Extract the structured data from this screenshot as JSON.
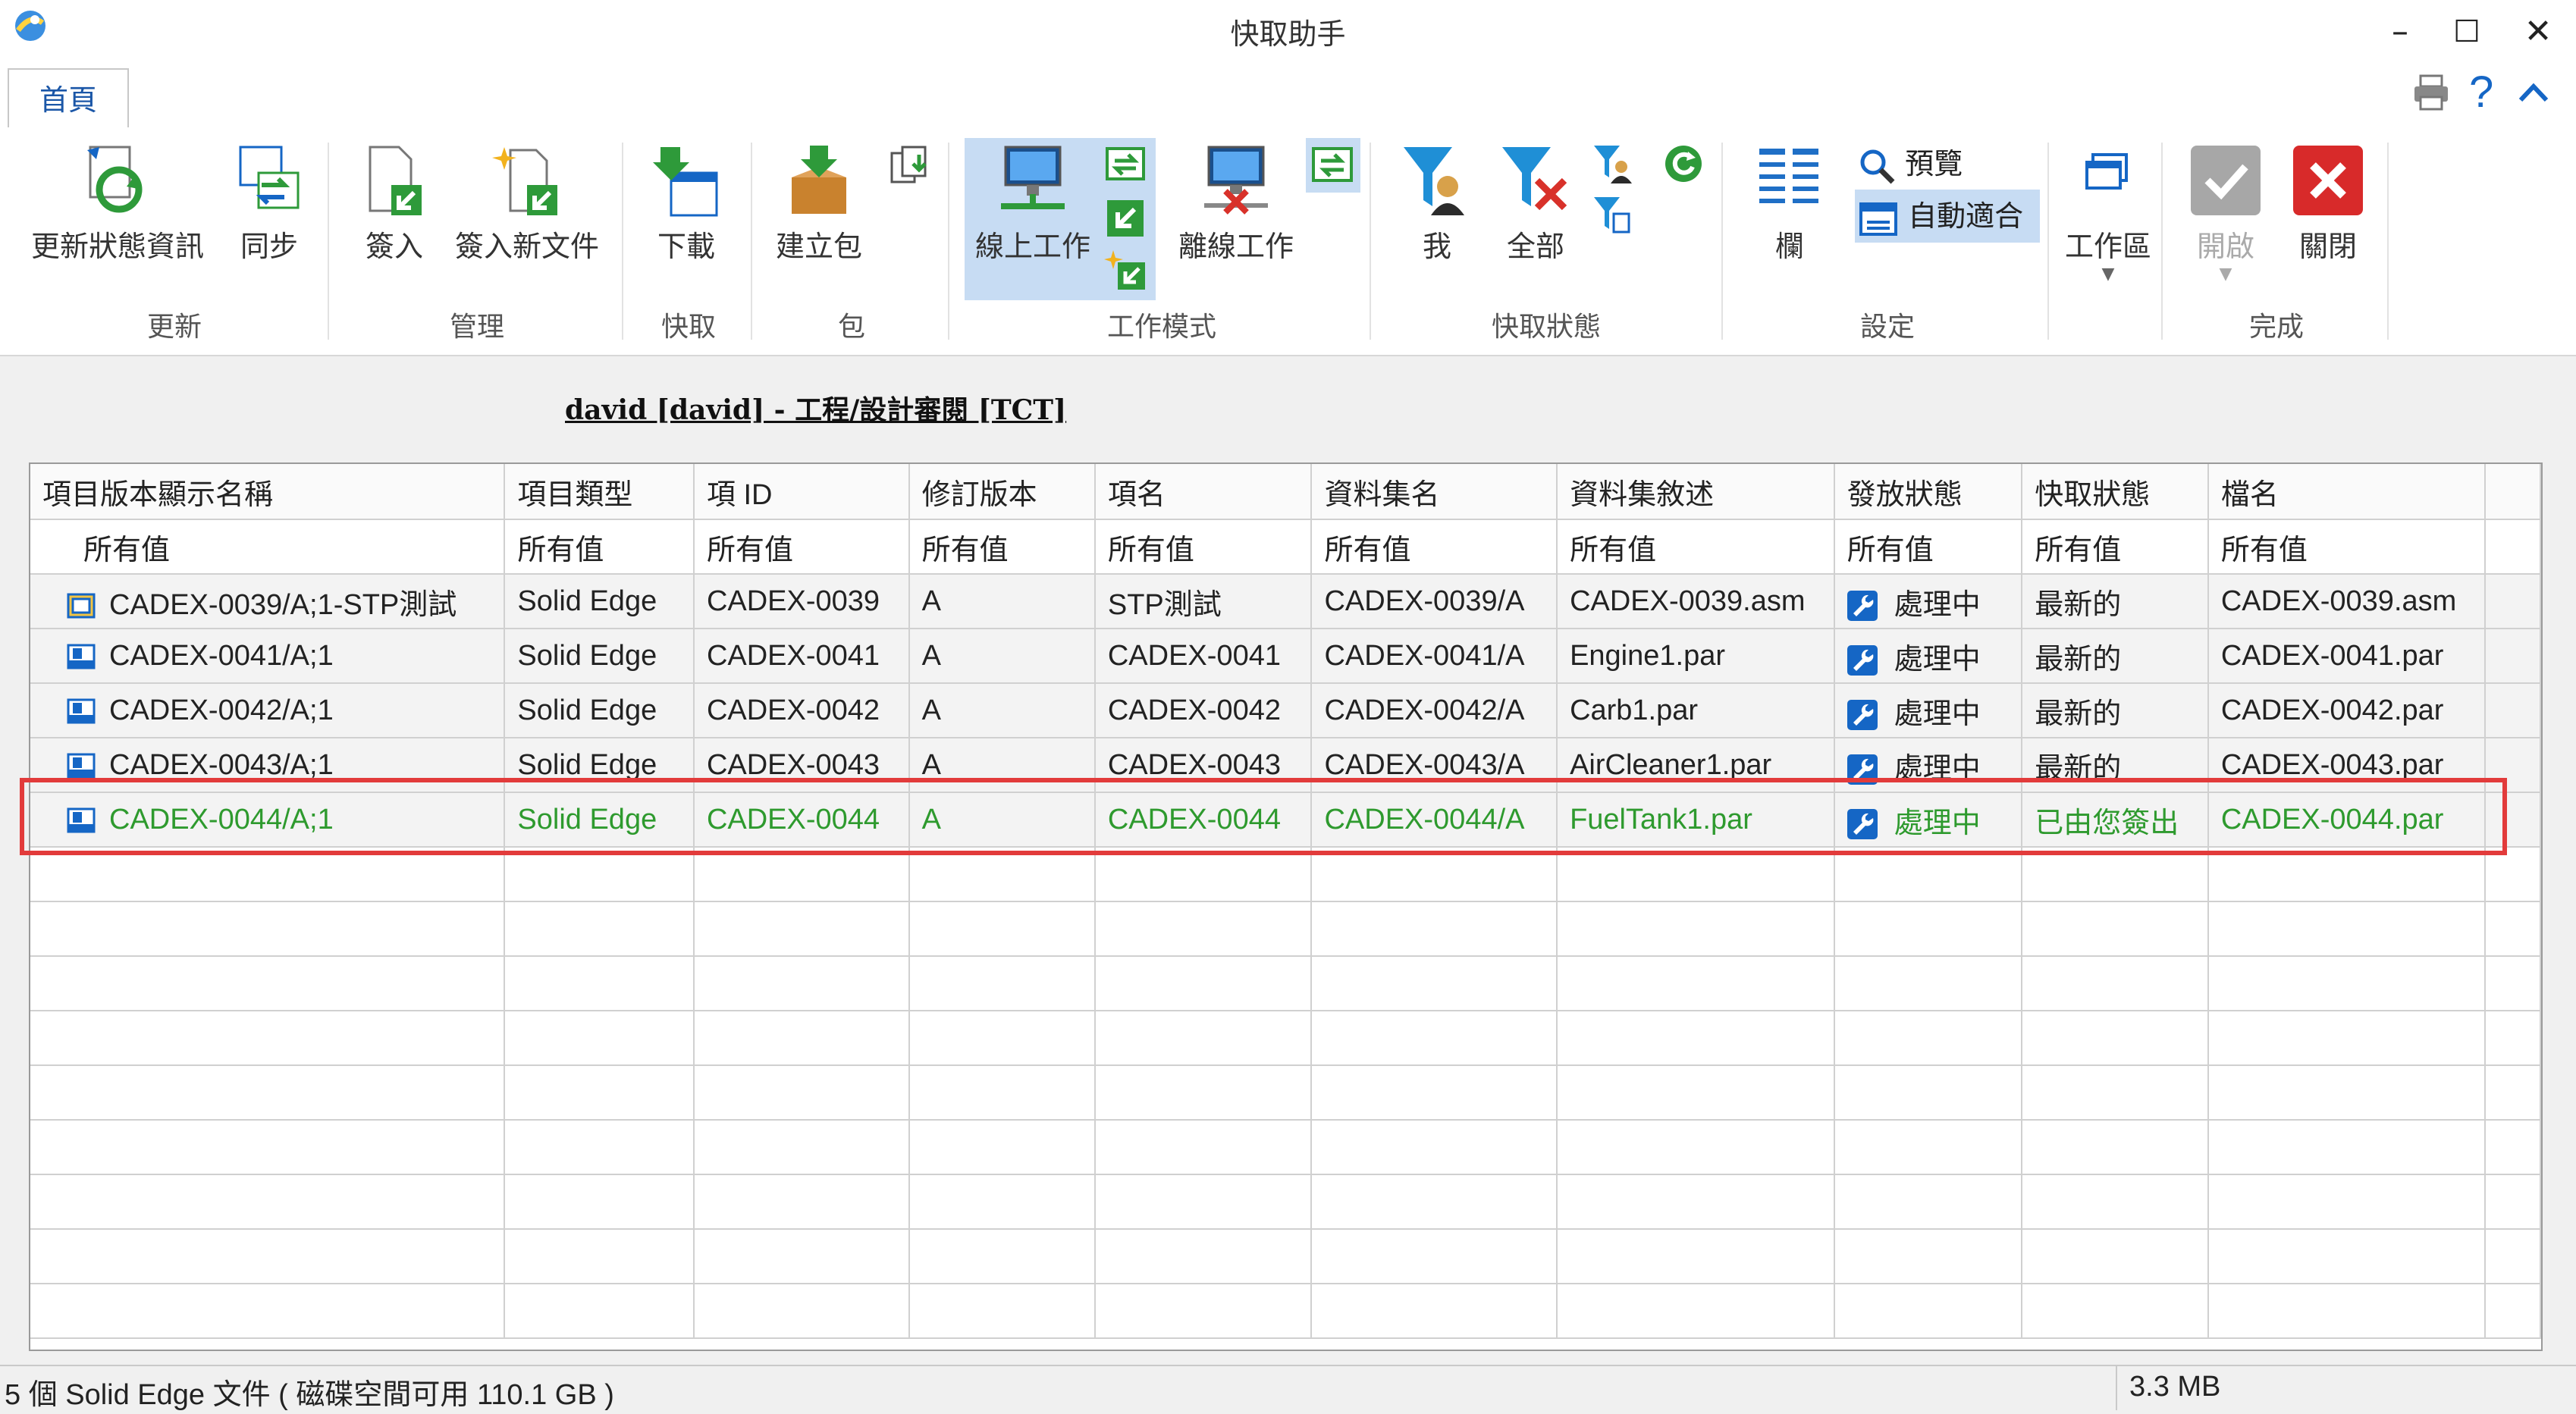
{
  "window": {
    "title": "快取助手",
    "minimize": "–",
    "maximize": "☐",
    "close": "✕"
  },
  "tabs": [
    {
      "label": "首頁",
      "active": true
    }
  ],
  "ribbon": {
    "groups": {
      "update": "更新",
      "manage": "管理",
      "cache": "快取",
      "package": "包",
      "work_mode": "工作模式",
      "cache_status": "快取狀態",
      "settings": "設定",
      "finish": "完成"
    },
    "buttons": {
      "refresh_status": "更新狀態資訊",
      "sync": "同步",
      "check_in": "簽入",
      "check_in_new": "簽入新文件",
      "download": "下載",
      "create_package": "建立包",
      "online": "線上工作",
      "offline": "離線工作",
      "me": "我",
      "all": "全部",
      "columns": "欄",
      "preview": "預覽",
      "auto_fit": "自動適合",
      "workspace": "工作區",
      "open": "開啟",
      "close": "關閉"
    }
  },
  "context_title": "david [david] - 工程/設計審閱 [TCT]",
  "grid": {
    "columns": [
      "項目版本顯示名稱",
      "項目類型",
      "項 ID",
      "修訂版本",
      "項名",
      "資料集名",
      "資料集敘述",
      "發放狀態",
      "快取狀態",
      "檔名"
    ],
    "filter_label": "所有值",
    "rows": [
      {
        "name": "CADEX-0039/A;1-STP測試",
        "type": "Solid Edge",
        "id": "CADEX-0039",
        "rev": "A",
        "item_name": "STP測試",
        "dataset": "CADEX-0039/A",
        "desc": "CADEX-0039.asm",
        "release": "處理中",
        "cache": "最新的",
        "file": "CADEX-0039.asm",
        "icon": "assembly-icon",
        "selected": false
      },
      {
        "name": "CADEX-0041/A;1",
        "type": "Solid Edge",
        "id": "CADEX-0041",
        "rev": "A",
        "item_name": "CADEX-0041",
        "dataset": "CADEX-0041/A",
        "desc": "Engine1.par",
        "release": "處理中",
        "cache": "最新的",
        "file": "CADEX-0041.par",
        "icon": "part-icon",
        "selected": false
      },
      {
        "name": "CADEX-0042/A;1",
        "type": "Solid Edge",
        "id": "CADEX-0042",
        "rev": "A",
        "item_name": "CADEX-0042",
        "dataset": "CADEX-0042/A",
        "desc": "Carb1.par",
        "release": "處理中",
        "cache": "最新的",
        "file": "CADEX-0042.par",
        "icon": "part-icon",
        "selected": false
      },
      {
        "name": "CADEX-0043/A;1",
        "type": "Solid Edge",
        "id": "CADEX-0043",
        "rev": "A",
        "item_name": "CADEX-0043",
        "dataset": "CADEX-0043/A",
        "desc": "AirCleaner1.par",
        "release": "處理中",
        "cache": "最新的",
        "file": "CADEX-0043.par",
        "icon": "part-icon",
        "selected": false
      },
      {
        "name": "CADEX-0044/A;1",
        "type": "Solid Edge",
        "id": "CADEX-0044",
        "rev": "A",
        "item_name": "CADEX-0044",
        "dataset": "CADEX-0044/A",
        "desc": "FuelTank1.par",
        "release": "處理中",
        "cache": "已由您簽出",
        "file": "CADEX-0044.par",
        "icon": "part-icon",
        "selected": true
      }
    ]
  },
  "status": {
    "left": "5 個 Solid Edge 文件 ( 磁碟空間可用 110.1 GB )",
    "right": "3.3 MB"
  },
  "colors": {
    "accent": "#1a56a7",
    "selected_text": "#2e9a2e",
    "highlight_border": "#e23b3b",
    "online_active_bg": "#c7dcf3"
  }
}
